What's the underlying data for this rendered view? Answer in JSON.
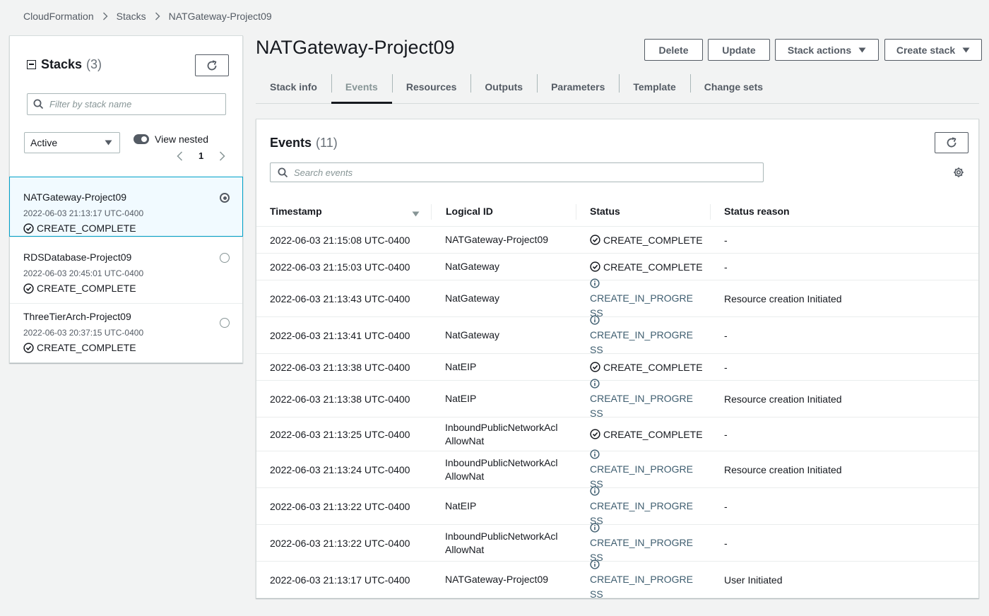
{
  "breadcrumb": [
    "CloudFormation",
    "Stacks",
    "NATGateway-Project09"
  ],
  "stacks_panel": {
    "title": "Stacks",
    "count": "(3)",
    "filter_placeholder": "Filter by stack name",
    "status_filter": "Active",
    "view_nested_label": "View nested",
    "page": "1",
    "items": [
      {
        "name": "NATGateway-Project09",
        "date": "2022-06-03 21:13:17 UTC-0400",
        "status": "CREATE_COMPLETE",
        "selected": true
      },
      {
        "name": "RDSDatabase-Project09",
        "date": "2022-06-03 20:45:01 UTC-0400",
        "status": "CREATE_COMPLETE",
        "selected": false
      },
      {
        "name": "ThreeTierArch-Project09",
        "date": "2022-06-03 20:37:15 UTC-0400",
        "status": "CREATE_COMPLETE",
        "selected": false
      }
    ]
  },
  "header": {
    "title": "NATGateway-Project09",
    "buttons": {
      "delete": "Delete",
      "update": "Update",
      "stack_actions": "Stack actions",
      "create_stack": "Create stack"
    }
  },
  "tabs": [
    "Stack info",
    "Events",
    "Resources",
    "Outputs",
    "Parameters",
    "Template",
    "Change sets"
  ],
  "active_tab": "Events",
  "events": {
    "title": "Events",
    "count": "(11)",
    "search_placeholder": "Search events",
    "columns": [
      "Timestamp",
      "Logical ID",
      "Status",
      "Status reason"
    ],
    "rows": [
      {
        "timestamp": "2022-06-03 21:15:08 UTC-0400",
        "logical_id": [
          "NATGateway-Project09"
        ],
        "status": "CREATE_COMPLETE",
        "status_lines": [
          "CREATE_COMPLETE"
        ],
        "reason": "-"
      },
      {
        "timestamp": "2022-06-03 21:15:03 UTC-0400",
        "logical_id": [
          "NatGateway"
        ],
        "status": "CREATE_COMPLETE",
        "status_lines": [
          "CREATE_COMPLETE"
        ],
        "reason": "-"
      },
      {
        "timestamp": "2022-06-03 21:13:43 UTC-0400",
        "logical_id": [
          "NatGateway"
        ],
        "status": "CREATE_IN_PROGRESS",
        "status_lines": [
          "CREATE_IN_PROGRE",
          "SS"
        ],
        "reason": "Resource creation Initiated"
      },
      {
        "timestamp": "2022-06-03 21:13:41 UTC-0400",
        "logical_id": [
          "NatGateway"
        ],
        "status": "CREATE_IN_PROGRESS",
        "status_lines": [
          "CREATE_IN_PROGRE",
          "SS"
        ],
        "reason": "-"
      },
      {
        "timestamp": "2022-06-03 21:13:38 UTC-0400",
        "logical_id": [
          "NatEIP"
        ],
        "status": "CREATE_COMPLETE",
        "status_lines": [
          "CREATE_COMPLETE"
        ],
        "reason": "-"
      },
      {
        "timestamp": "2022-06-03 21:13:38 UTC-0400",
        "logical_id": [
          "NatEIP"
        ],
        "status": "CREATE_IN_PROGRESS",
        "status_lines": [
          "CREATE_IN_PROGRE",
          "SS"
        ],
        "reason": "Resource creation Initiated"
      },
      {
        "timestamp": "2022-06-03 21:13:25 UTC-0400",
        "logical_id": [
          "InboundPublicNetworkAcl",
          "AllowNat"
        ],
        "status": "CREATE_COMPLETE",
        "status_lines": [
          "CREATE_COMPLETE"
        ],
        "reason": "-"
      },
      {
        "timestamp": "2022-06-03 21:13:24 UTC-0400",
        "logical_id": [
          "InboundPublicNetworkAcl",
          "AllowNat"
        ],
        "status": "CREATE_IN_PROGRESS",
        "status_lines": [
          "CREATE_IN_PROGRE",
          "SS"
        ],
        "reason": "Resource creation Initiated"
      },
      {
        "timestamp": "2022-06-03 21:13:22 UTC-0400",
        "logical_id": [
          "NatEIP"
        ],
        "status": "CREATE_IN_PROGRESS",
        "status_lines": [
          "CREATE_IN_PROGRE",
          "SS"
        ],
        "reason": "-"
      },
      {
        "timestamp": "2022-06-03 21:13:22 UTC-0400",
        "logical_id": [
          "InboundPublicNetworkAcl",
          "AllowNat"
        ],
        "status": "CREATE_IN_PROGRESS",
        "status_lines": [
          "CREATE_IN_PROGRE",
          "SS"
        ],
        "reason": "-"
      },
      {
        "timestamp": "2022-06-03 21:13:17 UTC-0400",
        "logical_id": [
          "NATGateway-Project09"
        ],
        "status": "CREATE_IN_PROGRESS",
        "status_lines": [
          "CREATE_IN_PROGRE",
          "SS"
        ],
        "reason": "User Initiated"
      }
    ]
  },
  "colors": {
    "success": "#16191f",
    "in_progress": "#3e5d6f",
    "selected_bg": "#f1faff",
    "selected_border": "#00a1c9",
    "border": "#d5dbdb"
  },
  "icons": [
    "chevron-right-icon",
    "collapse-icon",
    "refresh-icon",
    "search-icon",
    "caret-down-icon",
    "chevron-left-icon",
    "check-circle-icon",
    "info-circle-icon",
    "gear-icon",
    "sort-icon"
  ]
}
